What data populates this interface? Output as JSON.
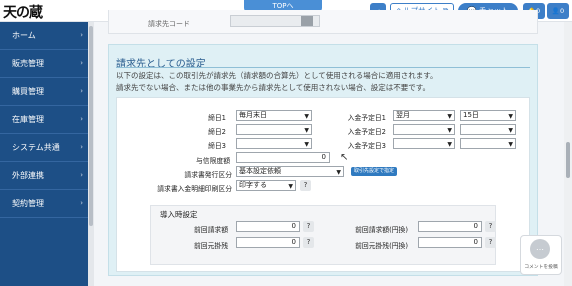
{
  "header": {
    "logo": "天の蔵",
    "top_tab": "TOPへ",
    "help_label": "ヘルプサイト",
    "chat_label": "チャット",
    "notif_count": "0",
    "user_count": "0"
  },
  "sidebar": {
    "items": [
      {
        "label": "ホーム"
      },
      {
        "label": "販売管理"
      },
      {
        "label": "購買管理"
      },
      {
        "label": "在庫管理"
      },
      {
        "label": "システム共通"
      },
      {
        "label": "外部連携"
      },
      {
        "label": "契約管理"
      }
    ]
  },
  "previous_section": {
    "label": "請求先コード"
  },
  "billing": {
    "title": "請求先としての設定",
    "desc1": "以下の設定は、この取引先が請求先（請求額の合算先）として使用される場合に適用されます。",
    "desc2": "請求先でない場合、または他の事業先から請求先として使用されない場合、設定は不要です。",
    "closing1": {
      "label": "締日1",
      "value": "毎月末日"
    },
    "closing2": {
      "label": "締日2",
      "value": ""
    },
    "closing3": {
      "label": "締日3",
      "value": ""
    },
    "payment1": {
      "label": "入金予定日1",
      "month": "翌月",
      "day": "15日"
    },
    "payment2": {
      "label": "入金予定日2",
      "month": "",
      "day": ""
    },
    "payment3": {
      "label": "入金予定日3",
      "month": "",
      "day": ""
    },
    "credit_limit": {
      "label": "与信限度額",
      "value": "0"
    },
    "invoice_type": {
      "label": "請求書発行区分",
      "value": "基本設定依頼",
      "tag": "取引先設定で指定"
    },
    "deposit_print": {
      "label": "請求書入金明細印刷区分",
      "value": "印字する"
    }
  },
  "intro": {
    "title": "導入時設定",
    "fields": [
      {
        "label": "前回請求額",
        "value": "0"
      },
      {
        "label": "前回請求額(円換)",
        "value": "0"
      },
      {
        "label": "前回元掛残",
        "value": "0"
      },
      {
        "label": "前回元掛残(円換)",
        "value": "0"
      }
    ]
  },
  "comment": {
    "label": "コメントを投稿"
  }
}
